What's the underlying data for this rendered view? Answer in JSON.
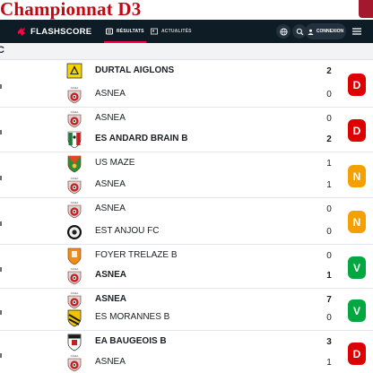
{
  "banner": {
    "title": "Championnat D3"
  },
  "navbar": {
    "brand": "FLASHSCORE",
    "tabs": [
      {
        "label": "RÉSULTATS",
        "active": true
      },
      {
        "label": "ACTUALITÉS",
        "active": false
      }
    ],
    "login_label": "CONNEXION"
  },
  "section": {
    "letter": "C"
  },
  "colors": {
    "loss": "#dc0000",
    "draw": "#f3a000",
    "win": "#00a83f",
    "accent": "#ff0046"
  },
  "matches": [
    {
      "home": "DURTAL AIGLONS",
      "home_bold": true,
      "home_crest": "durtal-aiglons-crest",
      "away": "ASNEA",
      "away_bold": false,
      "away_crest": "asnea-crest",
      "home_score": "2",
      "away_score": "0",
      "home_score_bold": true,
      "away_score_bold": false,
      "result": "D"
    },
    {
      "home": "ASNEA",
      "home_bold": false,
      "home_crest": "asnea-crest",
      "away": "ES ANDARD BRAIN B",
      "away_bold": true,
      "away_crest": "es-andard-brain-crest",
      "home_score": "0",
      "away_score": "2",
      "home_score_bold": false,
      "away_score_bold": true,
      "result": "D"
    },
    {
      "home": "US MAZE",
      "home_bold": false,
      "home_crest": "us-maze-crest",
      "away": "ASNEA",
      "away_bold": false,
      "away_crest": "asnea-crest",
      "home_score": "1",
      "away_score": "1",
      "home_score_bold": false,
      "away_score_bold": false,
      "result": "N"
    },
    {
      "home": "ASNEA",
      "home_bold": false,
      "home_crest": "asnea-crest",
      "away": "EST ANJOU FC",
      "away_bold": false,
      "away_crest": "est-anjou-fc-crest",
      "home_score": "0",
      "away_score": "0",
      "home_score_bold": false,
      "away_score_bold": false,
      "result": "N"
    },
    {
      "home": "FOYER TRELAZE B",
      "home_bold": false,
      "home_crest": "foyer-trelaze-crest",
      "away": "ASNEA",
      "away_bold": true,
      "away_crest": "asnea-crest",
      "home_score": "0",
      "away_score": "1",
      "home_score_bold": false,
      "away_score_bold": true,
      "result": "V"
    },
    {
      "home": "ASNEA",
      "home_bold": true,
      "home_crest": "asnea-crest",
      "away": "ES MORANNES B",
      "away_bold": false,
      "away_crest": "es-morannes-crest",
      "home_score": "7",
      "away_score": "0",
      "home_score_bold": true,
      "away_score_bold": false,
      "result": "V"
    },
    {
      "home": "EA BAUGEOIS B",
      "home_bold": true,
      "home_crest": "ea-baugeois-crest",
      "away": "ASNEA",
      "away_bold": false,
      "away_crest": "asnea-crest",
      "home_score": "3",
      "away_score": "1",
      "home_score_bold": true,
      "away_score_bold": false,
      "result": "D"
    }
  ]
}
